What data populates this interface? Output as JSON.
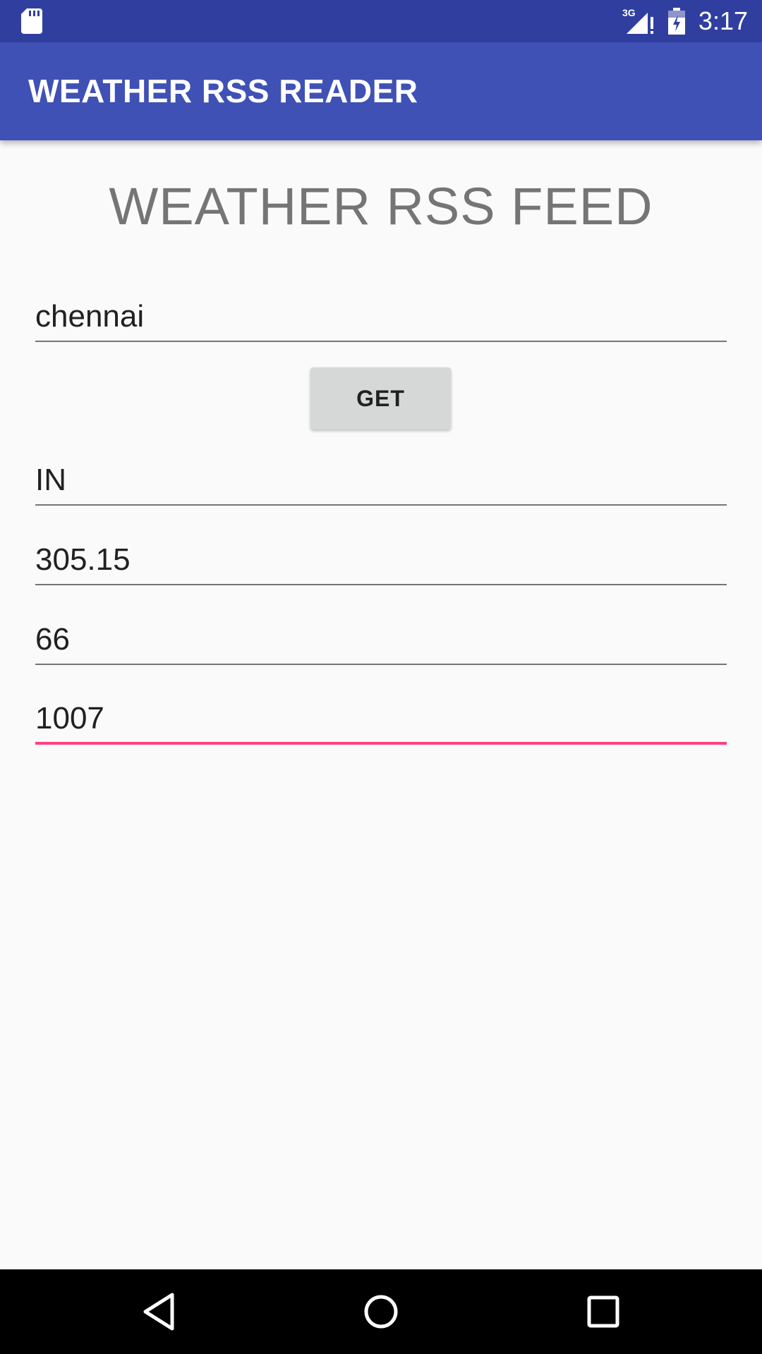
{
  "status_bar": {
    "time": "3:17",
    "network": "3G",
    "icons": [
      "sd-card-icon",
      "signal-3g-icon",
      "battery-charging-icon"
    ]
  },
  "app_bar": {
    "title": "WEATHER RSS READER"
  },
  "main": {
    "heading": "WEATHER RSS FEED",
    "city_input": {
      "value": "chennai"
    },
    "get_button": {
      "label": "GET"
    },
    "country_field": {
      "value": "IN"
    },
    "temperature_field": {
      "value": "305.15"
    },
    "humidity_field": {
      "value": "66"
    },
    "pressure_field": {
      "value": "1007"
    }
  },
  "colors": {
    "status_bar": "#303f9f",
    "app_bar": "#3f51b5",
    "accent": "#ff4081",
    "background": "#fafafa"
  },
  "nav_bar": {
    "icons": [
      "back-icon",
      "home-icon",
      "recents-icon"
    ]
  }
}
